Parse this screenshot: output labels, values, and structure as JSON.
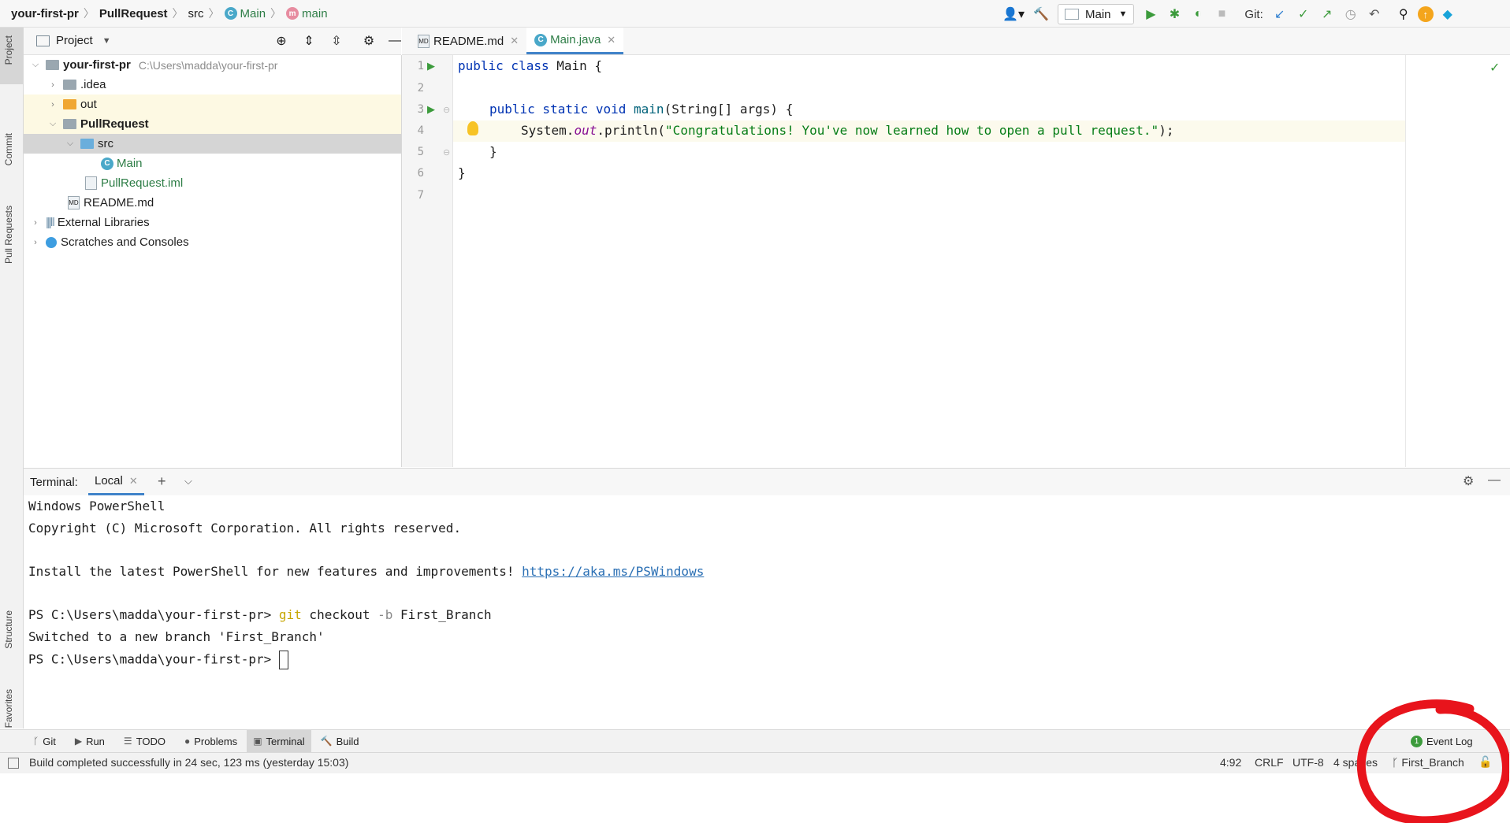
{
  "navbar": {
    "breadcrumbs": [
      "your-first-pr",
      "PullRequest",
      "src",
      "Main",
      "main"
    ],
    "run_config": "Main",
    "git_label": "Git:"
  },
  "left_strip": {
    "tabs": [
      "Project",
      "Commit",
      "Pull Requests",
      "Structure",
      "Favorites"
    ]
  },
  "project": {
    "header": "Project",
    "root": {
      "name": "your-first-pr",
      "path": "C:\\Users\\madda\\your-first-pr"
    },
    "items": [
      ".idea",
      "out",
      "PullRequest",
      "src",
      "Main",
      "PullRequest.iml",
      "README.md",
      "External Libraries",
      "Scratches and Consoles"
    ]
  },
  "editor": {
    "tabs": [
      {
        "label": "README.md"
      },
      {
        "label": "Main.java"
      }
    ],
    "line_numbers": [
      "1",
      "2",
      "3",
      "4",
      "5",
      "6",
      "7"
    ],
    "code": {
      "l1_kw": "public class ",
      "l1_rest": "Main {",
      "l3_kw": "public static void ",
      "l3_fn": "main",
      "l3_rest": "(String[] args) {",
      "l4_a": "System.",
      "l4_fld": "out",
      "l4_b": ".println(",
      "l4_str": "\"Congratulations! You've now learned how to open a pull request.\"",
      "l4_c": ");",
      "l5": "}",
      "l6": "}"
    }
  },
  "terminal": {
    "title": "Terminal:",
    "tab": "Local",
    "lines": {
      "l1": "Windows PowerShell",
      "l2": "Copyright (C) Microsoft Corporation. All rights reserved.",
      "l3_text": "Install the latest PowerShell for new features and improvements! ",
      "l3_link": "https://aka.ms/PSWindows",
      "l4_prompt": "PS C:\\Users\\madda\\your-first-pr> ",
      "l4_git": "git",
      "l4_cmd": " checkout ",
      "l4_flag": "-b",
      "l4_arg": " First_Branch",
      "l5": "Switched to a new branch 'First_Branch'",
      "l6_prompt": "PS C:\\Users\\madda\\your-first-pr> "
    }
  },
  "tool_tabs": [
    "Git",
    "Run",
    "TODO",
    "Problems",
    "Terminal",
    "Build"
  ],
  "event_log": {
    "count": "1",
    "label": "Event Log"
  },
  "status": {
    "message": "Build completed successfully in 24 sec, 123 ms (yesterday 15:03)",
    "position": "4:92",
    "line_sep": "CRLF",
    "encoding": "UTF-8",
    "indent": "4 spaces",
    "branch": "First_Branch"
  },
  "colors": {
    "accent": "#4083c9",
    "annotation": "#e8141c"
  }
}
